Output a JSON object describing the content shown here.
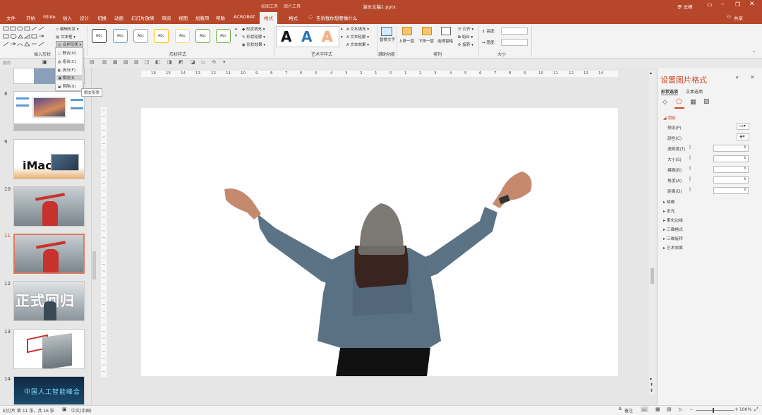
{
  "title_bar": {
    "doc_title": "演示文稿1.pptx",
    "context_tab_1": "绘图工具",
    "context_tab_2": "图片工具",
    "user": "罗 云峰"
  },
  "tabs": [
    "文件",
    "开始",
    "iSlide",
    "插入",
    "设计",
    "切换",
    "动画",
    "幻灯片放映",
    "审阅",
    "视图",
    "加载项",
    "帮助",
    "ACROBAT",
    "格式",
    "格式"
  ],
  "tell_me": "告诉我你想要做什么",
  "share": "共享",
  "ribbon": {
    "edit_shape": "编辑形状",
    "text_box": "文本框",
    "merge_shapes": "合并形状",
    "insert_shapes_label": "插入形状",
    "abc": "Abc",
    "shape_fill": "形状填充",
    "shape_outline": "形状轮廓",
    "shape_effects": "形状效果",
    "shape_styles_label": "形状样式",
    "wordart_letter": "A",
    "text_fill": "文本填充",
    "text_outline": "文本轮廓",
    "text_effects": "文本效果",
    "wordart_label": "艺术字样式",
    "alt_text": "替换文字",
    "accessibility_label": "辅助功能",
    "bring_forward": "上移一层",
    "send_backward": "下移一层",
    "selection_pane": "选择窗格",
    "align": "对齐",
    "group": "组合",
    "rotate": "旋转",
    "arrange_label": "排列",
    "height": "高度:",
    "width": "宽度:",
    "size_label": "大小"
  },
  "merge_menu": {
    "items": [
      "联合(U)",
      "组合(C)",
      "拆分(F)",
      "相交(I)",
      "剪除(S)"
    ],
    "tooltip": "相交形状"
  },
  "qat": {
    "undo_text": "撤消"
  },
  "ruler": {
    "h_ticks": [
      "16",
      "15",
      "14",
      "13",
      "12",
      "11",
      "10",
      "9",
      "8",
      "7",
      "6",
      "5",
      "4",
      "3",
      "2",
      "1",
      "0",
      "1",
      "2",
      "3",
      "4",
      "5",
      "6",
      "7",
      "8",
      "9",
      "10",
      "11",
      "12",
      "13",
      "14",
      "15",
      "16"
    ]
  },
  "slides": [
    {
      "num": "8",
      "kind": "imac"
    },
    {
      "num": "9",
      "kind": "imac2",
      "text": "iMac"
    },
    {
      "num": "10",
      "kind": "photo"
    },
    {
      "num": "11",
      "kind": "photo",
      "selected": true
    },
    {
      "num": "12",
      "kind": "text",
      "text": "正式回归"
    },
    {
      "num": "13",
      "kind": "photo2"
    },
    {
      "num": "14",
      "kind": "dark",
      "text": "中国人工智能峰会"
    }
  ],
  "format_pane": {
    "title": "设置图片格式",
    "tab_shape": "形状选项",
    "tab_text": "文本选项",
    "shadow": "阴影",
    "props": [
      {
        "label": "预设(P)"
      },
      {
        "label": "颜色(C)"
      },
      {
        "label": "透明度(T)"
      },
      {
        "label": "大小(S)"
      },
      {
        "label": "模糊(B)"
      },
      {
        "label": "角度(A)"
      },
      {
        "label": "距离(D)"
      }
    ],
    "sections": [
      "映像",
      "发光",
      "柔化边缘",
      "三维格式",
      "三维旋转",
      "艺术效果"
    ]
  },
  "status": {
    "slide_info": "幻灯片 第 11 张，共 16 张",
    "language": "中文(中国)",
    "notes": "备注",
    "zoom": "100%"
  },
  "colors": {
    "accent": "#b7472a"
  }
}
